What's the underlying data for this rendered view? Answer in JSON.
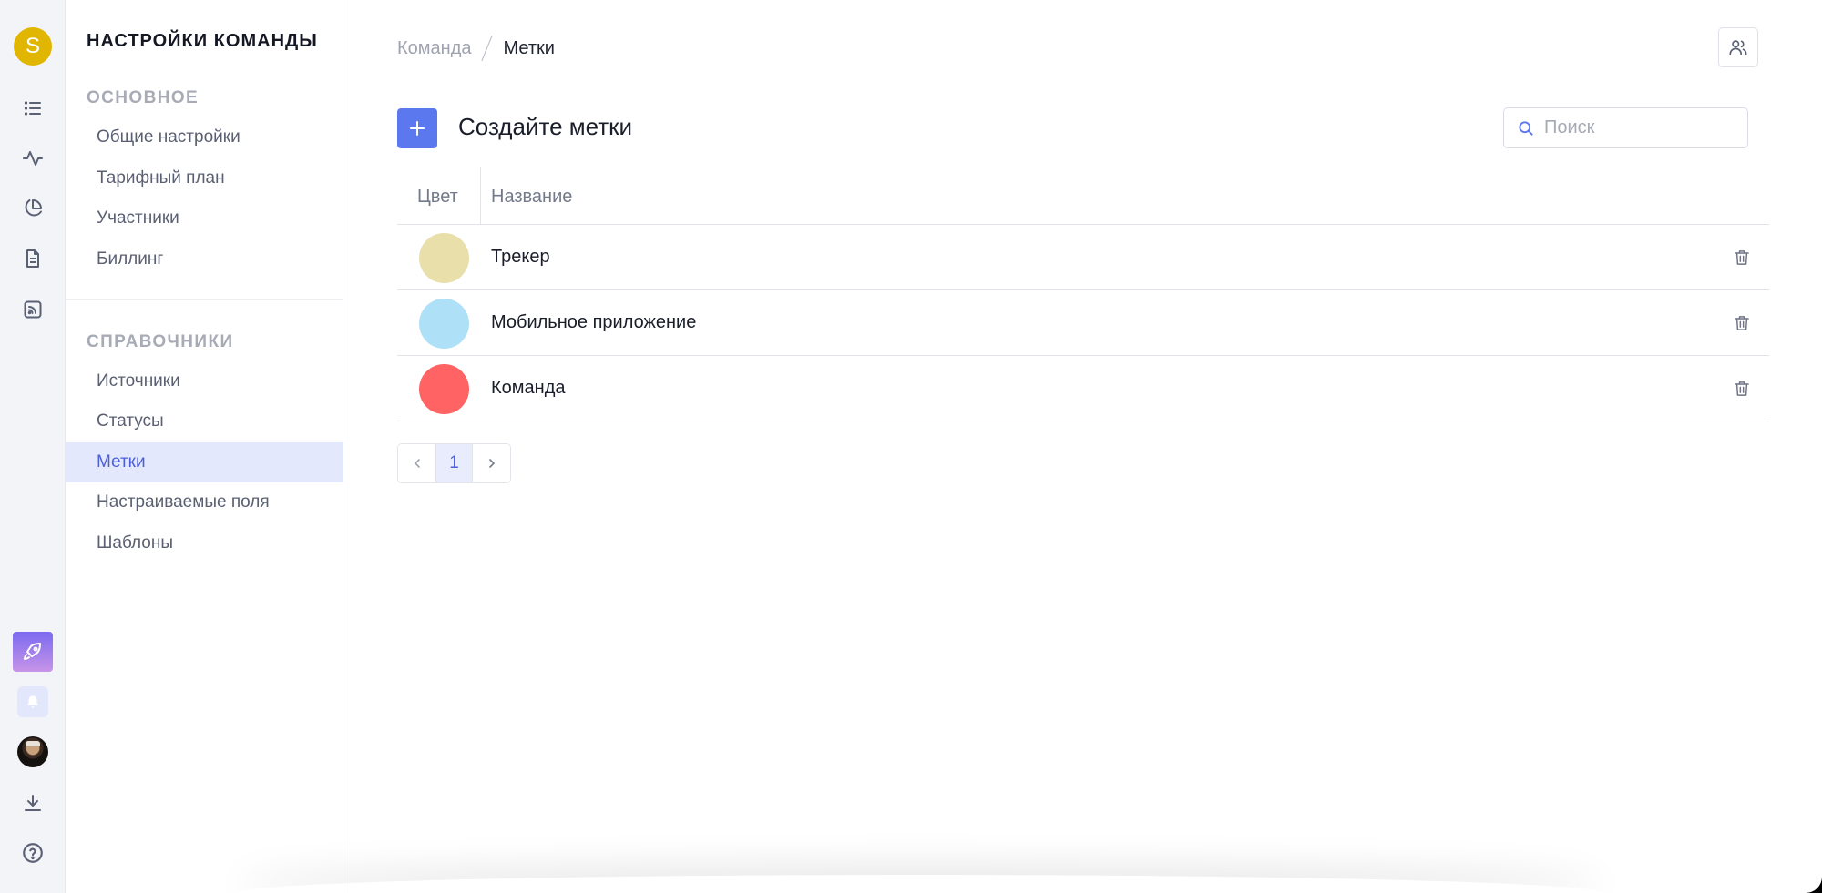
{
  "rail": {
    "avatar_letter": "S",
    "avatar_color": "#e1b600",
    "nav_icons": [
      "list-icon",
      "activity-icon",
      "pie-chart-icon",
      "document-icon",
      "rss-icon"
    ],
    "bottom_icons": [
      "rocket-icon",
      "bell-icon",
      "user-photo",
      "download-icon",
      "help-icon"
    ]
  },
  "sidebar": {
    "title": "НАСТРОЙКИ КОМАНДЫ",
    "groups": [
      {
        "label": "ОСНОВНОЕ",
        "items": [
          {
            "label": "Общие настройки"
          },
          {
            "label": "Тарифный план"
          },
          {
            "label": "Участники"
          },
          {
            "label": "Биллинг"
          }
        ]
      },
      {
        "label": "СПРАВОЧНИКИ",
        "items": [
          {
            "label": "Источники"
          },
          {
            "label": "Статусы"
          },
          {
            "label": "Метки",
            "active": true
          },
          {
            "label": "Настраиваемые поля"
          },
          {
            "label": "Шаблоны"
          }
        ]
      }
    ]
  },
  "breadcrumb": {
    "parent": "Команда",
    "current": "Метки"
  },
  "header": {
    "title": "Создайте метки",
    "add_icon": "plus-icon",
    "team_icon": "team-icon"
  },
  "search": {
    "placeholder": "Поиск",
    "value": ""
  },
  "table": {
    "columns": [
      "Цвет",
      "Название"
    ],
    "rows": [
      {
        "color": "#e8dfaa",
        "name": "Трекер"
      },
      {
        "color": "#aee0f8",
        "name": "Мобильное приложение"
      },
      {
        "color": "#ff6363",
        "name": "Команда"
      }
    ]
  },
  "pagination": {
    "current": "1"
  },
  "colors": {
    "accent": "#5c78ef",
    "active_bg": "#e4e8fc"
  }
}
